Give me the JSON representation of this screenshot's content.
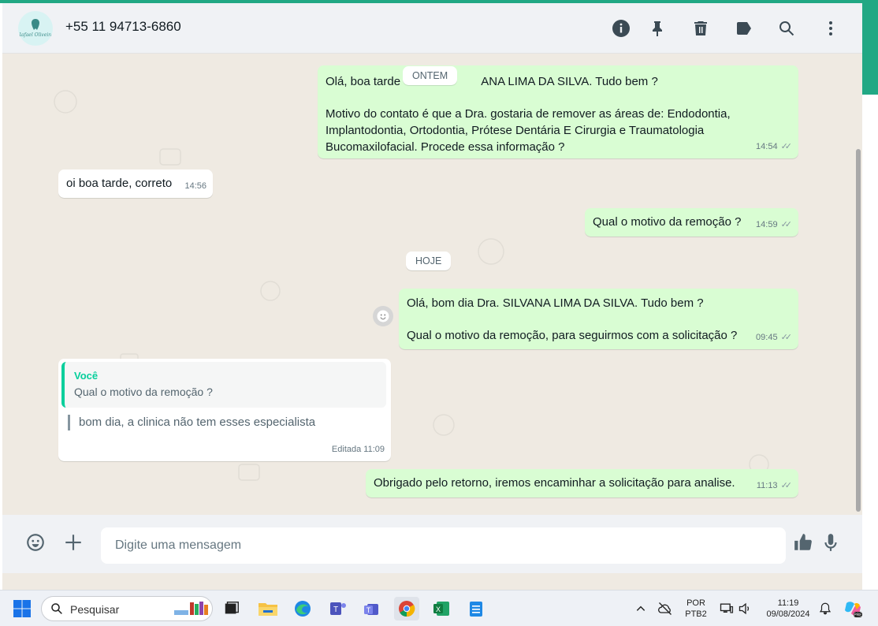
{
  "header": {
    "contact_name": "+55 11 94713-6860",
    "icons": [
      "info-icon",
      "pin-icon",
      "trash-icon",
      "label-icon",
      "search-icon",
      "more-vertical-icon"
    ]
  },
  "chat": {
    "date_yesterday": "ONTEM",
    "date_today": "HOJE",
    "messages": [
      {
        "direction": "out",
        "lines": [
          "Olá, boa tarde",
          "ANA LIMA DA SILVA. Tudo bem ?",
          "Motivo do contato é que a Dra. gostaria de remover as áreas de: Endodontia,",
          "Implantodontia, Ortodontia, Prótese Dentária E Cirurgia e Traumatologia",
          "Bucomaxilofacial. Procede essa informação ?"
        ],
        "time": "14:54"
      },
      {
        "direction": "in",
        "text": "oi boa tarde, correto",
        "time": "14:56"
      },
      {
        "direction": "out",
        "text": "Qual o motivo da remoção ?",
        "time": "14:59"
      },
      {
        "direction": "out",
        "lines": [
          "Olá, bom dia Dra. SILVANA LIMA DA SILVA. Tudo bem ?",
          "Qual o motivo da remoção, para seguirmos com a solicitação ?"
        ],
        "time": "09:45"
      },
      {
        "direction": "in",
        "quote_author": "Você",
        "quote_text": "Qual o motivo da remoção ?",
        "text": "bom dia, a clinica não tem esses especialista",
        "time": "Editada 11:09"
      },
      {
        "direction": "out",
        "text": "Obrigado pelo retorno, iremos encaminhar a solicitação para analise.",
        "time": "11:13"
      }
    ]
  },
  "footer": {
    "placeholder": "Digite uma mensagem"
  },
  "taskbar": {
    "search_label": "Pesquisar",
    "language": "POR",
    "keyboard": "PTB2",
    "clock_time": "11:19",
    "clock_date": "09/08/2024"
  },
  "colors": {
    "accent": "#21a884",
    "outgoing_bubble": "#d9fdd3",
    "incoming_bubble": "#ffffff",
    "chat_background": "#efeae2",
    "quote_accent": "#06cf9c"
  }
}
